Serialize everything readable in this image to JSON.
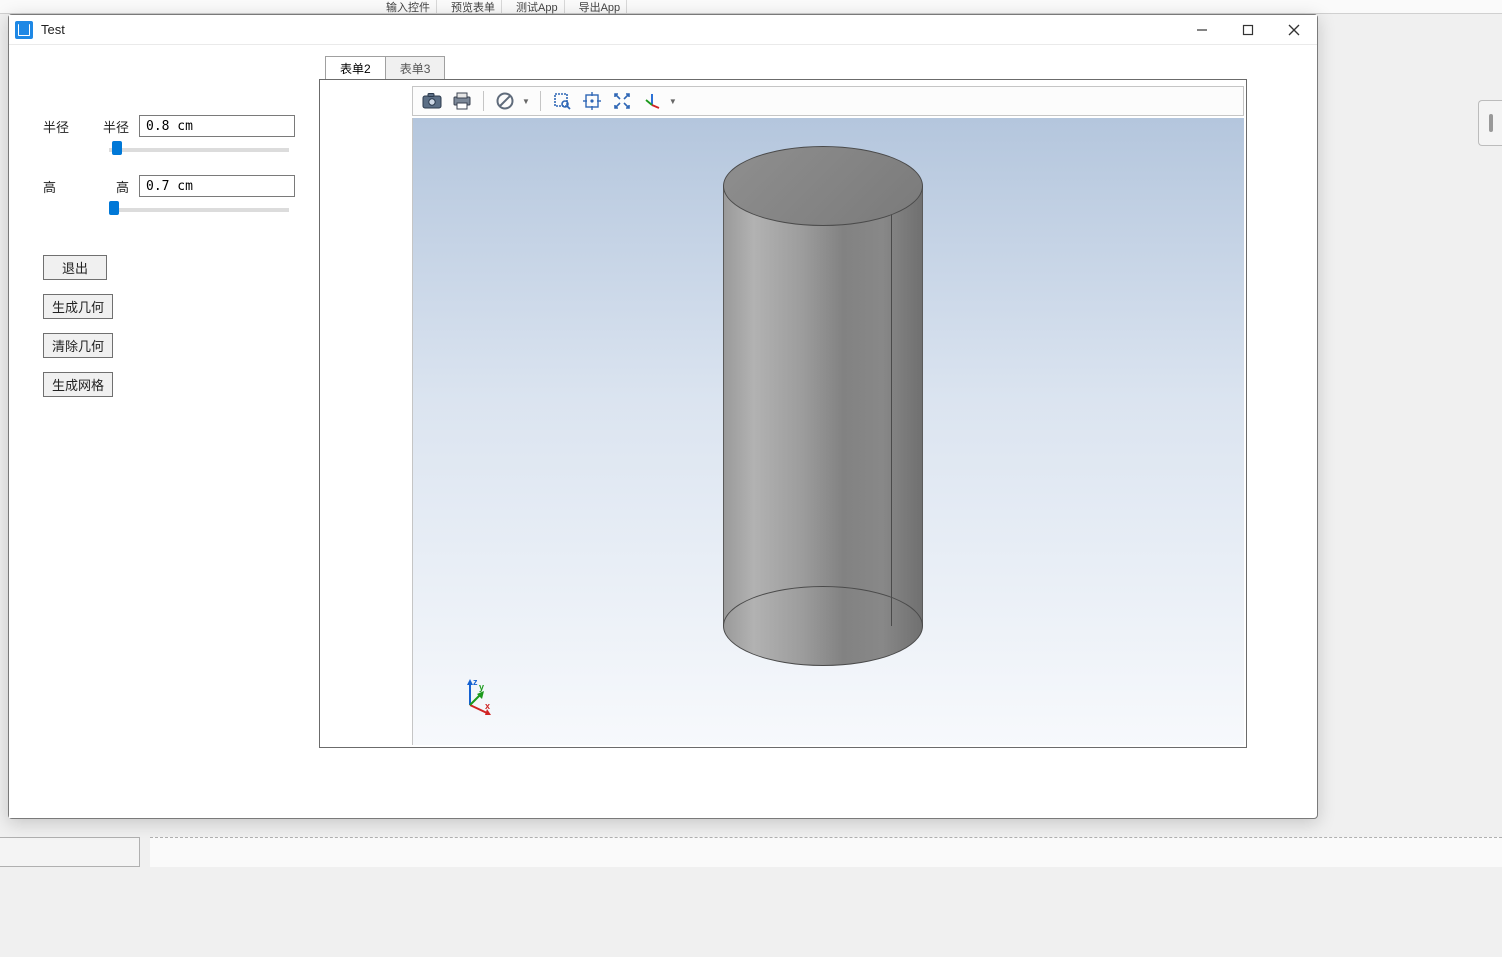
{
  "parent_ribbon": {
    "input_controls": "输入控件",
    "preview_form": "预览表单",
    "test_app": "测试App",
    "export_app": "导出App"
  },
  "window": {
    "title": "Test"
  },
  "params": {
    "radius": {
      "outer_label": "半径",
      "inner_label": "半径",
      "value": "0.8 cm",
      "slider_min": 0,
      "slider_max": 100,
      "slider_value": 2
    },
    "height": {
      "outer_label": "高",
      "inner_label": "高",
      "value": "0.7 cm",
      "slider_min": 0,
      "slider_max": 100,
      "slider_value": 0
    }
  },
  "actions": {
    "exit": "退出",
    "gen_geom": "生成几何",
    "clear_geom": "清除几何",
    "gen_mesh": "生成网格"
  },
  "tabs": [
    {
      "label": "表单2",
      "active": true
    },
    {
      "label": "表单3",
      "active": false
    }
  ],
  "gfx_toolbar": {
    "screenshot": "screenshot",
    "print": "print",
    "block": "toggle-display",
    "zoom_box": "zoom-box",
    "pan": "zoom-extents-pan",
    "zoom_extents": "zoom-extents",
    "orient": "view-orientation"
  },
  "axes": {
    "x": "x",
    "y": "y",
    "z": "z"
  }
}
